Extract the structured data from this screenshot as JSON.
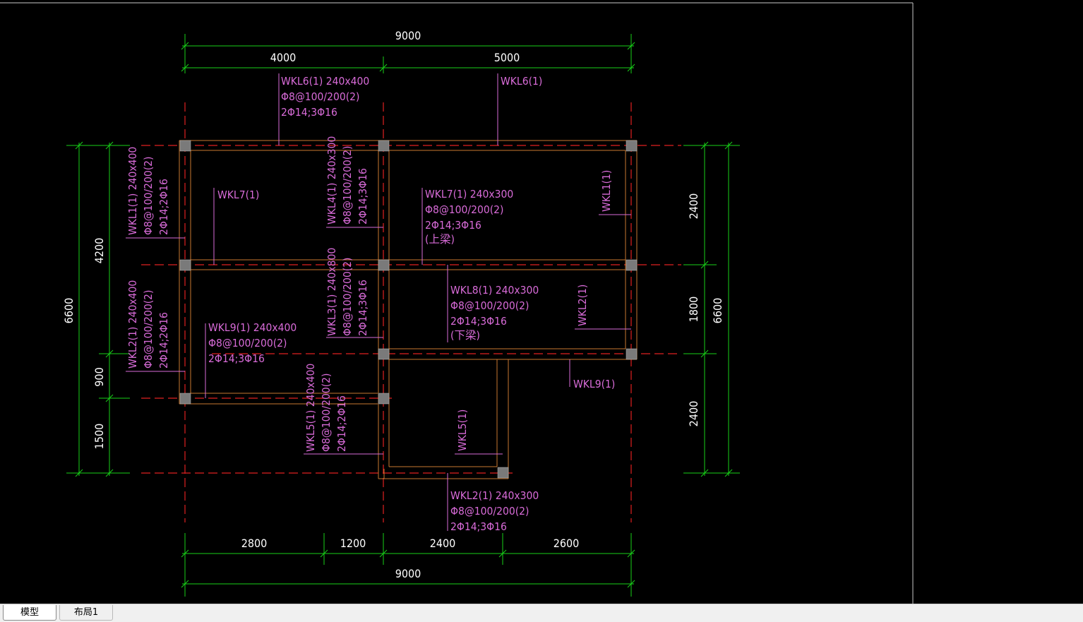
{
  "app": {
    "active_tab": "布局1"
  },
  "tabs": [
    {
      "label": "模型"
    },
    {
      "label": "布局1"
    }
  ],
  "dimensions": {
    "top_total": "9000",
    "top_left": "4000",
    "top_right": "5000",
    "bottom_2800": "2800",
    "bottom_1200": "1200",
    "bottom_2400": "2400",
    "bottom_2600": "2600",
    "bottom_total": "9000",
    "left_total": "6600",
    "left_4200": "4200",
    "left_900": "900",
    "left_1500": "1500",
    "right_2400_top": "2400",
    "right_1800": "1800",
    "right_2400_bottom": "2400",
    "right_total": "6600"
  },
  "annotations": {
    "wkl6_a": [
      "WKL6(1) 240x400",
      "Φ8@100/200(2)",
      "2Φ14;3Φ16"
    ],
    "wkl6_b": "WKL6(1)",
    "wkl7_a": "WKL7(1)",
    "wkl7_b": [
      "WKL7(1) 240x300",
      "Φ8@100/200(2)",
      "2Φ14;3Φ16",
      "(上梁)"
    ],
    "wkl1_a": [
      "WKL1(1) 240x400",
      "Φ8@100/200(2)",
      "2Φ14;2Φ16"
    ],
    "wkl1_b": "WKL1(1)",
    "wkl4": [
      "WKL4(1) 240x300",
      "Φ8@100/200(2)",
      "2Φ14;3Φ16"
    ],
    "wkl3": [
      "WKL3(1) 240x800",
      "Φ8@100/200(2)",
      "2Φ14;3Φ16"
    ],
    "wkl2_a": [
      "WKL2(1) 240x400",
      "Φ8@100/200(2)",
      "2Φ14;2Φ16"
    ],
    "wkl2_b": "WKL2(1)",
    "wkl2_c": [
      "WKL2(1) 240x300",
      "Φ8@100/200(2)",
      "2Φ14;3Φ16"
    ],
    "wkl8": [
      "WKL8(1) 240x300",
      "Φ8@100/200(2)",
      "2Φ14;3Φ16",
      "(下梁)"
    ],
    "wkl9_a": [
      "WKL9(1) 240x400",
      "Φ8@100/200(2)",
      "2Φ14;3Φ16"
    ],
    "wkl9_b": "WKL9(1)",
    "wkl5_a": [
      "WKL5(1) 240x400",
      "Φ8@100/200(2)",
      "2Φ14;2Φ16"
    ],
    "wkl5_b": "WKL5(1)"
  },
  "colors": {
    "background": "#000000",
    "grid_axis": "#e02020",
    "beam": "#c87830",
    "dimension": "#18d018",
    "annotation": "#d86bd8",
    "column": "#7a7a7a",
    "text": "#ffffff"
  }
}
